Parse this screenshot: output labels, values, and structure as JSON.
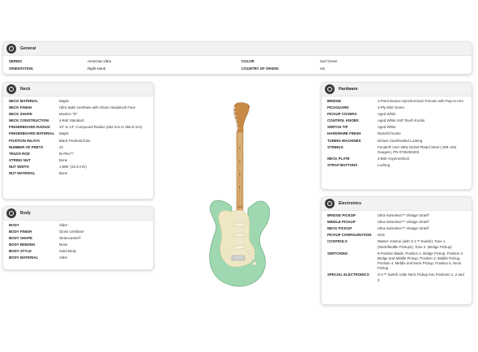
{
  "general": {
    "title": "General",
    "left": [
      {
        "key": "SERIES",
        "value": "American Ultra"
      },
      {
        "key": "ORIENTATION",
        "value": "Right-Hand"
      }
    ],
    "right": [
      {
        "key": "COLOR",
        "value": "Surf Green"
      },
      {
        "key": "COUNTRY OF ORIGIN",
        "value": "US"
      }
    ]
  },
  "neck": {
    "title": "Neck",
    "rows": [
      {
        "key": "NECK MATERIAL",
        "value": "Maple"
      },
      {
        "key": "NECK FINISH",
        "value": "Ultra Satin Urethane with Gloss Headstock Face"
      },
      {
        "key": "NECK SHAPE",
        "value": "Modern \"D\""
      },
      {
        "key": "NECK CONSTRUCTION",
        "value": "4-Bolt Standard"
      },
      {
        "key": "FINGERBOARD RADIUS",
        "value": "10\" to 14\" Compound Radius (254 mm to 355.6 mm)"
      },
      {
        "key": "FINGERBOARD MATERIAL",
        "value": "Maple"
      },
      {
        "key": "POSITION INLAYS",
        "value": "Black Pearloid Dots"
      },
      {
        "key": "NUMBER OF FRETS",
        "value": "22"
      },
      {
        "key": "TRUSS ROD",
        "value": "Bi-Flex™"
      },
      {
        "key": "STRING NUT",
        "value": "Bone"
      },
      {
        "key": "NUT WIDTH",
        "value": "1.685\" (42.8 mm)"
      },
      {
        "key": "NUT MATERIAL",
        "value": "Bone"
      }
    ]
  },
  "body": {
    "title": "Body",
    "rows": [
      {
        "key": "BODY",
        "value": "Alder"
      },
      {
        "key": "BODY FINISH",
        "value": "Gloss Urethane"
      },
      {
        "key": "BODY SHAPE",
        "value": "Stratocaster®"
      },
      {
        "key": "BODY BINDING",
        "value": "None"
      },
      {
        "key": "BODY STYLE",
        "value": "Solid Body"
      },
      {
        "key": "BODY MATERIAL",
        "value": "Alder"
      }
    ]
  },
  "hardware": {
    "title": "Hardware",
    "rows": [
      {
        "key": "BRIDGE",
        "value": "2-Point Deluxe Synchronized Tremolo with Pop-In Arm"
      },
      {
        "key": "PICKGUARD",
        "value": "3-Ply Mint Green"
      },
      {
        "key": "PICKUP COVERS",
        "value": "Aged White"
      },
      {
        "key": "CONTROL KNOBS",
        "value": "Aged White Soft Touch Knobs"
      },
      {
        "key": "SWITCH TIP",
        "value": "Aged White"
      },
      {
        "key": "HARDWARE FINISH",
        "value": "Nickel/Chrome"
      },
      {
        "key": "TUNING MACHINES",
        "value": "Deluxe Cast/Sealed Locking"
      },
      {
        "key": "STRINGS",
        "value": "Fender® USA 250L Nickel Plated Steel (.009-.042 Gauges), PN 0730250403"
      },
      {
        "key": "NECK PLATE",
        "value": "4-Bolt Asymmetrical"
      },
      {
        "key": "STRAP BUTTONS",
        "value": "Locking"
      }
    ]
  },
  "electronics": {
    "title": "Electronics",
    "rows": [
      {
        "key": "BRIDGE PICKUP",
        "value": "Ultra Noiseless™ Vintage Strat®"
      },
      {
        "key": "MIDDLE PICKUP",
        "value": "Ultra Noiseless™ Vintage Strat®"
      },
      {
        "key": "NECK PICKUP",
        "value": "Ultra Noiseless™ Vintage Strat®"
      },
      {
        "key": "PICKUP CONFIGURATION",
        "value": "SSS"
      },
      {
        "key": "CONTROLS",
        "value": "Master Volume (with S-1™ Switch), Tone 1. (Neck/Middle Pickups), Tone 2. (Bridge Pickup)"
      },
      {
        "key": "SWITCHING",
        "value": "5-Position Blade: Position 1. Bridge Pickup, Position 2. Bridge and Middle Pickup, Position 3. Middle Pickup, Position 4. Middle and Neck Pickup, Position 5. Neck Pickup"
      },
      {
        "key": "SPECIAL ELECTRONICS",
        "value": "S-1™ Switch Adds Neck Pickup Into Positions 1, 2 and 3"
      }
    ]
  },
  "colors": {
    "body_color": "#9fd8b0",
    "pickguard": "#efe7c4",
    "neck": "#d39a52",
    "icon": "#3a3a3a"
  },
  "icons": {
    "general": "gear-icon",
    "neck": "neck-icon",
    "body": "body-icon",
    "hardware": "hardware-icon",
    "electronics": "electronics-icon"
  }
}
